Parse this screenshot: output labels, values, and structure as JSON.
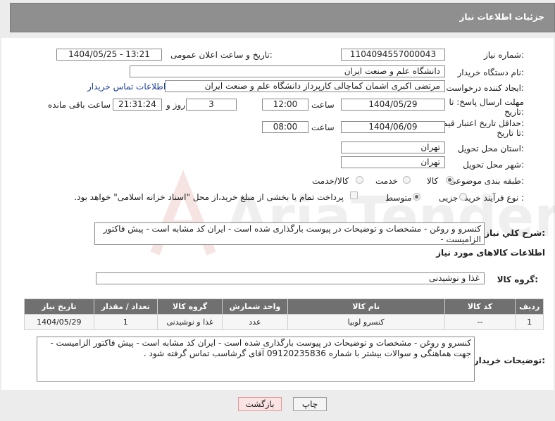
{
  "header": {
    "title": "جزئیات اطلاعات نیاز"
  },
  "fields": {
    "need_number_label": "شماره نیاز:",
    "need_number_value": "1104094557000043",
    "announce_label": "تاریخ و ساعت اعلان عمومی:",
    "announce_value": "1404/05/25 - 13:21",
    "buyer_org_label": "نام دستگاه خریدار:",
    "buyer_org_value": "دانشگاه علم و صنعت ایران",
    "creator_label": "ایجاد کننده درخواست:",
    "creator_value": "مرتضی اکبری اشمان کماچالی کارپرداز دانشگاه علم و صنعت ایران",
    "contact_link": "اطلاعات تماس خریدار",
    "reply_deadline_label_1": "مهلت ارسال پاسخ: تا",
    "reply_deadline_label_2": "تاریخ:",
    "reply_date": "1404/05/29",
    "time_label": "ساعت",
    "reply_time": "12:00",
    "days_value": "3",
    "days_label": "روز و",
    "remaining_time": "21:31:24",
    "remaining_label": "ساعت باقی مانده",
    "price_validity_label_1": "حداقل تاریخ اعتبار قیمت:",
    "price_validity_label_2": "تا تاریخ:",
    "price_validity_date": "1404/06/09",
    "price_validity_time": "08:00",
    "province_label": "استان محل تحویل:",
    "province_value": "تهران",
    "city_label": "شهر محل تحویل:",
    "city_value": "تهران",
    "category_label": "طبقه بندی موضوعی:",
    "category_options": [
      "کالا",
      "خدمت",
      "کالا/خدمت"
    ],
    "category_selected": "کالا",
    "process_label": "نوع فرآیند خرید :",
    "process_options": [
      "جزیی",
      "متوسط"
    ],
    "process_selected": "متوسط",
    "payment_note": "پرداخت تمام یا بخشی از مبلغ خرید،از محل \"اسناد خزانه اسلامی\" خواهد بود.",
    "description_label": "شرح کلي نياز:",
    "description_value": "کنسرو و روغن - مشخصات و توضیحات در پیوست بارگذاری شده است - ایران کد مشابه است - پیش فاکتور الزامیست -",
    "goods_info_title": "اطلاعات کالاهای مورد نیاز",
    "goods_group_label": "گروه کالا:",
    "goods_group_value": "غذا و نوشیدنی",
    "buyer_notes_label": "توضیحات خریدار:",
    "buyer_notes_value": "کنسرو و روغن - مشخصات و توضیحات در پیوست بارگذاری شده است - ایران کد مشابه است - پیش فاکتور الزامیست - جهت هماهنگی و سوالات بیشتر با شماره 09120235836 آقای گرشاسب تماس گرفته شود ."
  },
  "table": {
    "headers": [
      "ردیف",
      "کد کالا",
      "نام کالا",
      "واحد شمارش",
      "گروه کالا",
      "تعداد / مقدار",
      "تاریخ نیاز"
    ],
    "rows": [
      [
        "1",
        "--",
        "کنسرو لوبیا",
        "عدد",
        "غذا و نوشیدنی",
        "1",
        "1404/05/29"
      ]
    ]
  },
  "buttons": {
    "print": "چاپ",
    "back": "بازگشت"
  },
  "watermark_text": "AriaTender.neT",
  "colors": {
    "header_bg": "#8f8f8f",
    "table_header_bg": "#707070",
    "link": "#1a3f99",
    "watermark": "#c0392b"
  }
}
